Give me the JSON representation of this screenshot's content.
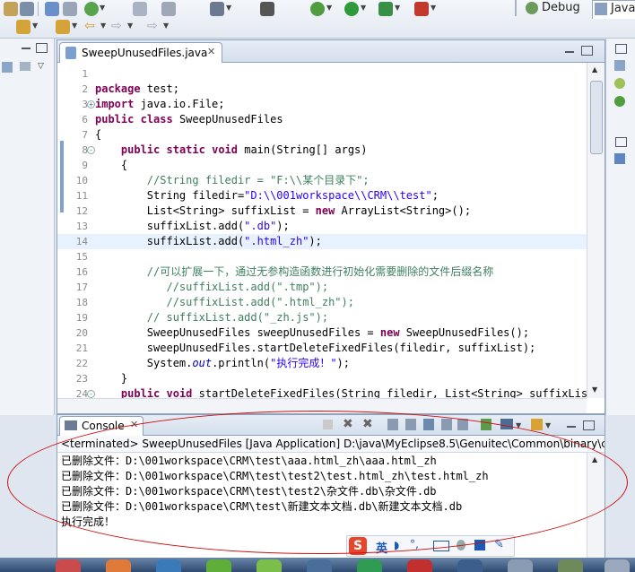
{
  "perspectives": {
    "debug": "Debug",
    "java": "Java"
  },
  "editor": {
    "tab_label": "SweepUnusedFiles.java",
    "tab_close": "✕",
    "lines": [
      {
        "n": "1",
        "code": ""
      },
      {
        "n": "2",
        "code": "package test;"
      },
      {
        "n": "3",
        "code": "import java.io.File;"
      },
      {
        "n": "6",
        "code": "public class SweepUnusedFiles"
      },
      {
        "n": "7",
        "code": "{"
      },
      {
        "n": "8",
        "code": "    public static void main(String[] args)"
      },
      {
        "n": "9",
        "code": "    {"
      },
      {
        "n": "10",
        "code": "        //String filedir = \"F:\\\\某个目录下\";"
      },
      {
        "n": "11",
        "code": "        String filedir=\"D:\\\\001workspace\\\\CRM\\\\test\";"
      },
      {
        "n": "12",
        "code": "        List<String> suffixList = new ArrayList<String>();"
      },
      {
        "n": "13",
        "code": "        suffixList.add(\".db\");"
      },
      {
        "n": "14",
        "code": "        suffixList.add(\".html_zh\");"
      },
      {
        "n": "15",
        "code": ""
      },
      {
        "n": "16",
        "code": "        //可以扩展一下，通过无参构造函数进行初始化需要删除的文件后缀名称"
      },
      {
        "n": "17",
        "code": "           //suffixList.add(\".tmp\");"
      },
      {
        "n": "18",
        "code": "           //suffixList.add(\".html_zh\");"
      },
      {
        "n": "19",
        "code": "        // suffixList.add(\"_zh.js\");"
      },
      {
        "n": "20",
        "code": "        SweepUnusedFiles sweepUnusedFiles = new SweepUnusedFiles();"
      },
      {
        "n": "21",
        "code": "        sweepUnusedFiles.startDeleteFixedFiles(filedir, suffixList);"
      },
      {
        "n": "22",
        "code": "        System.out.println(\"执行完成！\");"
      },
      {
        "n": "23",
        "code": "    }"
      },
      {
        "n": "24",
        "code": "    public void startDeleteFixedFiles(String filedir, List<String> suffixList)"
      }
    ]
  },
  "console": {
    "tab_label": "Console",
    "tab_close": "✕",
    "description": "<terminated> SweepUnusedFiles [Java Application] D:\\java\\MyEclipse8.5\\Genuitec\\Common\\binary\\com",
    "output": [
      "已删除文件：D:\\001workspace\\CRM\\test\\aaa.html_zh\\aaa.html_zh",
      "已删除文件：D:\\001workspace\\CRM\\test\\test2\\test.html_zh\\test.html_zh",
      "已删除文件：D:\\001workspace\\CRM\\test\\test2\\杂文件.db\\杂文件.db",
      "已删除文件：D:\\001workspace\\CRM\\test\\新建文本文档.db\\新建文本文档.db",
      "执行完成！"
    ]
  },
  "ime": {
    "mode": "英"
  },
  "colors": {
    "annotation": "#d01010",
    "current_line": "#e8f2fe",
    "keyword": "#7f0055",
    "comment": "#3f7f5f",
    "string": "#2a00ff"
  }
}
